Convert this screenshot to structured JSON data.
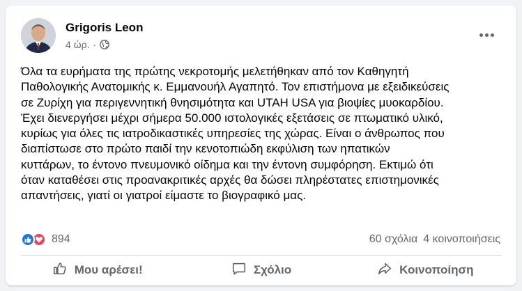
{
  "post": {
    "author": "Grigoris Leon",
    "time": "4 ώρ.",
    "separator": "·",
    "text": "Όλα τα ευρήματα της πρώτης νεκροτομής μελετήθηκαν από τον Καθηγητή\nΠαθολογικής Ανατομικής κ. Εμμανουήλ Αγαπητό. Τον επιστήμονα με εξειδικεύσεις\nσε Ζυρίχη για περιγεννητική θνησιμότητα και UTAH USA για βιοψίες μυοκαρδίου.\nΈχει διενεργήσει μέχρι σήμερα 50.000 ιστολογικές εξετάσεις σε πτωματικό υλικό,\nκυρίως για όλες τις ιατροδικαστικές υπηρεσίες της χώρας. Είναι ο άνθρωπος που\nδιαπίστωσε στο πρώτο παιδί την κενοτοπιώδη εκφύλιση των ηπατικών\nκυττάρων, το έντονο πνευμονικό οίδημα και την έντονη συμφόρηση. Εκτιμώ ότι\nόταν καταθέσει στις προανακριτικές αρχές θα δώσει πληρέστατες επιστημονικές\nαπαντήσεις, γιατί οι γιατροί είμαστε το βιογραφικό μας."
  },
  "stats": {
    "reaction_count": "894",
    "comments": "60 σχόλια",
    "shares": "4 κοινοποιήσεις"
  },
  "actions": {
    "like": "Μου αρέσει!",
    "comment": "Σχόλιο",
    "share": "Κοινοποίηση"
  },
  "icons": {
    "privacy": "globe-icon",
    "more": "more-options-icon",
    "like": "thumbs-up-icon",
    "comment": "comment-icon",
    "share": "share-icon"
  },
  "colors": {
    "like_blue": "#1b74e4",
    "love_red": "#f33e58",
    "secondary_text": "#65676b"
  }
}
